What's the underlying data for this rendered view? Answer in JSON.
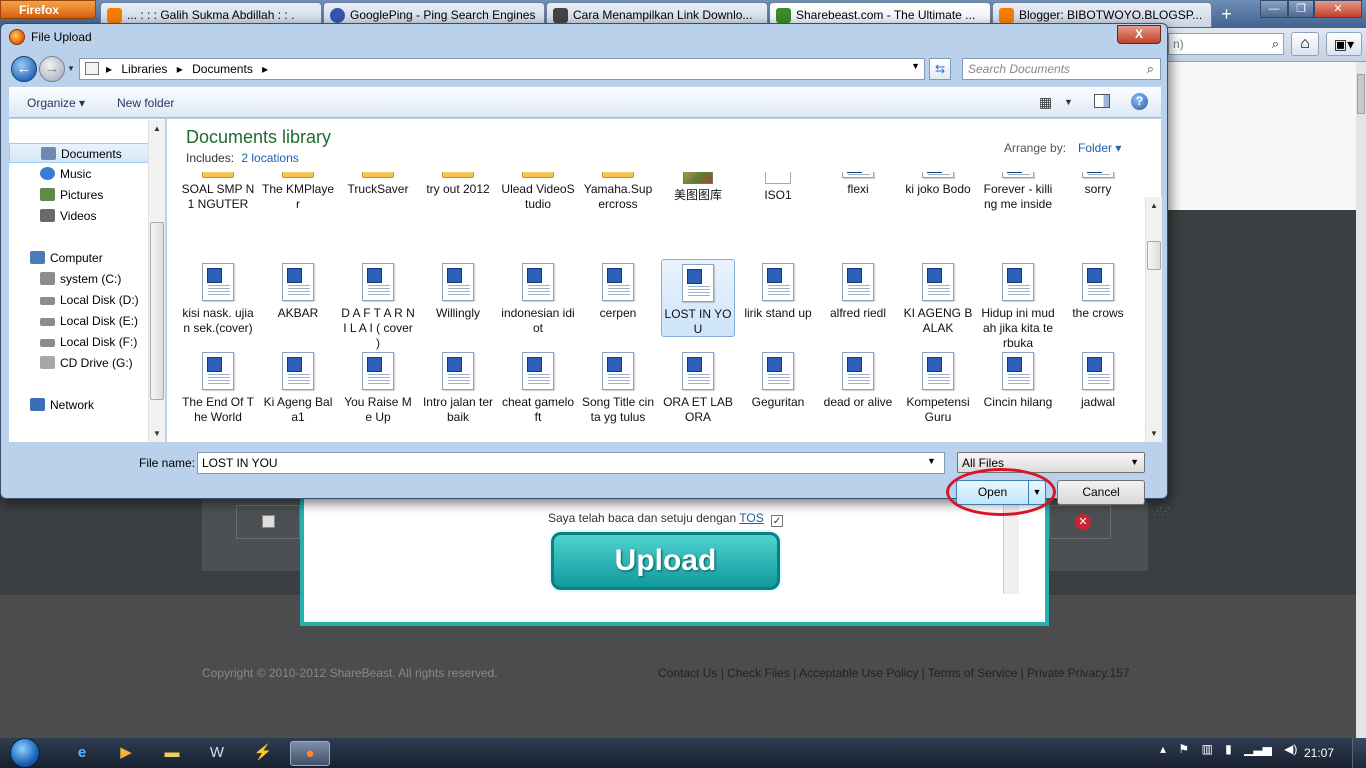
{
  "browser": {
    "menu_button": "Firefox",
    "tabs": [
      {
        "label": "... : : : Galih Sukma Abdillah : : .",
        "icon": "blogger-icon",
        "color": "#f57d00"
      },
      {
        "label": "GooglePing - Ping Search Engines",
        "icon": "ping-icon",
        "color": "#3355aa"
      },
      {
        "label": "Cara Menampilkan Link Downlo...",
        "icon": "page-icon",
        "color": "#444444"
      },
      {
        "label": "Sharebeast.com - The Ultimate ...",
        "icon": "sharebeast-icon",
        "color": "#3b8a2b"
      },
      {
        "label": "Blogger: BIBOTWOYO.BLOGSP...",
        "icon": "blogger-icon",
        "color": "#f57d00"
      }
    ],
    "search_fragment": "n)"
  },
  "page": {
    "tos_text": "Saya telah baca dan setuju dengan",
    "tos_link": "TOS",
    "upload_label": "Upload",
    "copyright": "Copyright © 2010-2012 ShareBeast. All rights reserved.",
    "footer_links": "Contact Us |  Check Files |  Acceptable Use Policy |  Terms of Service |  Private Privacy.157"
  },
  "dialog": {
    "title": "File Upload",
    "close_label": "X",
    "breadcrumbs": [
      "Libraries",
      "Documents"
    ],
    "search_placeholder": "Search Documents",
    "organize_label": "Organize",
    "new_folder_label": "New folder",
    "library_title": "Documents library",
    "includes_label": "Includes:",
    "includes_link": "2 locations",
    "arrange_label": "Arrange by:",
    "arrange_value": "Folder",
    "nav": [
      {
        "label": "Documents",
        "icon": "documents-icon",
        "selected": true,
        "color": "#6f8bb3"
      },
      {
        "label": "Music",
        "icon": "music-icon",
        "color": "#3a7bd5"
      },
      {
        "label": "Pictures",
        "icon": "pictures-icon",
        "color": "#5f8a4a"
      },
      {
        "label": "Videos",
        "icon": "videos-icon",
        "color": "#6a6a6a"
      },
      {
        "label": "Computer",
        "icon": "computer-icon",
        "color": "#4c7ab8"
      },
      {
        "label": "system (C:)",
        "icon": "drive-icon",
        "color": "#8c8c8c"
      },
      {
        "label": "Local Disk (D:)",
        "icon": "drive-icon",
        "color": "#8c8c8c"
      },
      {
        "label": "Local Disk (E:)",
        "icon": "drive-icon",
        "color": "#8c8c8c"
      },
      {
        "label": "Local Disk (F:)",
        "icon": "drive-icon",
        "color": "#8c8c8c"
      },
      {
        "label": "CD Drive (G:)",
        "icon": "cd-drive-icon",
        "color": "#a7a7a7"
      },
      {
        "label": "Network",
        "icon": "network-icon",
        "color": "#3a6fb5"
      }
    ],
    "files_row0": [
      {
        "name": "SOAL SMP N 1 NGUTER",
        "kind": "folder"
      },
      {
        "name": "The KMPlayer",
        "kind": "folder"
      },
      {
        "name": "TruckSaver",
        "kind": "folder"
      },
      {
        "name": "try out 2012",
        "kind": "folder"
      },
      {
        "name": "Ulead VideoStudio",
        "kind": "folder"
      },
      {
        "name": "Yamaha.Supercross",
        "kind": "folder"
      },
      {
        "name": "美图图库",
        "kind": "image"
      },
      {
        "name": "ISO1",
        "kind": "plain"
      },
      {
        "name": "flexi",
        "kind": "doc"
      },
      {
        "name": "ki joko Bodo",
        "kind": "doc"
      },
      {
        "name": "Forever - killing me inside",
        "kind": "doc"
      },
      {
        "name": "sorry",
        "kind": "doc"
      }
    ],
    "files_row1": [
      {
        "name": "kisi nask. ujian sek.(cover)"
      },
      {
        "name": "AKBAR"
      },
      {
        "name": "D A F T A R N I L A I ( cover )"
      },
      {
        "name": "Willingly"
      },
      {
        "name": "indonesian idiot"
      },
      {
        "name": "cerpen"
      },
      {
        "name": "LOST IN YOU",
        "selected": true
      },
      {
        "name": "lirik stand up"
      },
      {
        "name": "alfred riedl"
      },
      {
        "name": "KI AGENG BALAK"
      },
      {
        "name": "Hidup ini mudah jika kita terbuka"
      },
      {
        "name": "the crows"
      }
    ],
    "files_row2": [
      {
        "name": "The End Of The World"
      },
      {
        "name": "Ki Ageng Bala1"
      },
      {
        "name": "You Raise Me Up"
      },
      {
        "name": "Intro jalan terbaik"
      },
      {
        "name": "cheat gameloft"
      },
      {
        "name": "Song Title cinta yg tulus"
      },
      {
        "name": "ORA ET LABORA"
      },
      {
        "name": "Geguritan"
      },
      {
        "name": "dead or alive"
      },
      {
        "name": "Kompetensi Guru"
      },
      {
        "name": "Cincin hilang"
      },
      {
        "name": "jadwal"
      }
    ],
    "file_name_label": "File name:",
    "file_name_value": "LOST IN YOU",
    "filter_value": "All Files",
    "open_label": "Open",
    "cancel_label": "Cancel"
  },
  "taskbar": {
    "clock": "21:07"
  },
  "colors": {
    "accent_teal": "#22b2b0",
    "highlight_ring": "#d9142a",
    "library_title": "#1e6b2d",
    "link_blue": "#1c5fb4"
  }
}
